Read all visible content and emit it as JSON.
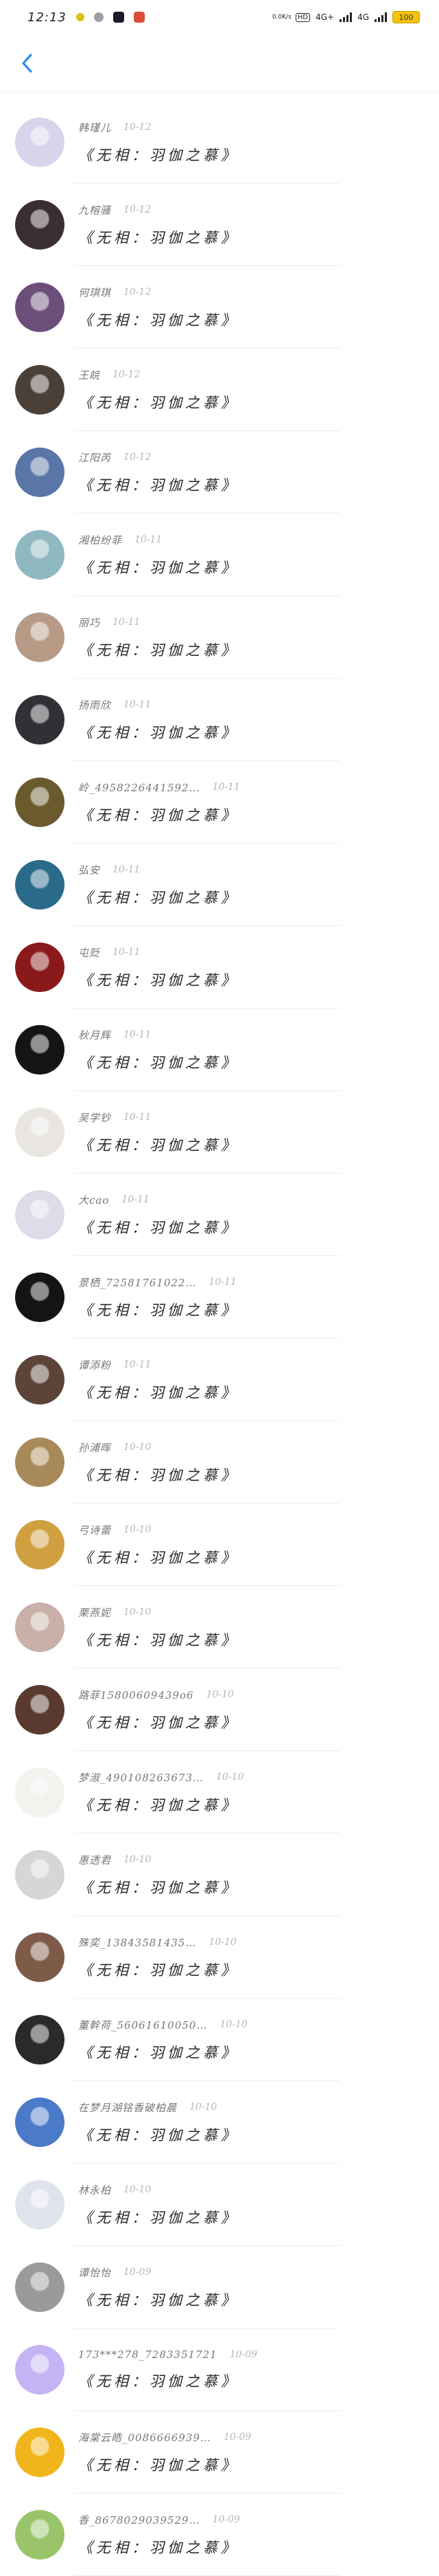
{
  "status": {
    "time": "12:13",
    "network_small": "0.0K/s",
    "net1": "4G+",
    "net2": "4G",
    "battery": "100"
  },
  "colors": {
    "accent": "#2d8cf0",
    "battery": "#f4c20d"
  },
  "nav": {
    "back_icon": "chevron-left-icon"
  },
  "contacts": [
    {
      "name": "韩瑾儿",
      "date": "10-12",
      "message": "《无相：羽伽之慕》",
      "avatar": "#d8d4ec"
    },
    {
      "name": "九榕骚",
      "date": "10-12",
      "message": "《无相：羽伽之慕》",
      "avatar": "#3a2e35"
    },
    {
      "name": "何琪琪",
      "date": "10-12",
      "message": "《无相：羽伽之慕》",
      "avatar": "#6b4e7a"
    },
    {
      "name": "王皖",
      "date": "10-12",
      "message": "《无相：羽伽之慕》",
      "avatar": "#4a4038"
    },
    {
      "name": "江阳芮",
      "date": "10-12",
      "message": "《无相：羽伽之慕》",
      "avatar": "#5a76a8"
    },
    {
      "name": "湘柏纷菲",
      "date": "10-11",
      "message": "《无相：羽伽之慕》",
      "avatar": "#8fb8c0"
    },
    {
      "name": "丽巧",
      "date": "10-11",
      "message": "《无相：羽伽之慕》",
      "avatar": "#b79a86"
    },
    {
      "name": "扬雨欣",
      "date": "10-11",
      "message": "《无相：羽伽之慕》",
      "avatar": "#2f3136"
    },
    {
      "name": "岭_4958226441592…",
      "date": "10-11",
      "message": "《无相：羽伽之慕》",
      "avatar": "#6b5a2e"
    },
    {
      "name": "弘安",
      "date": "10-11",
      "message": "《无相：羽伽之慕》",
      "avatar": "#2a6a8a"
    },
    {
      "name": "屯贬",
      "date": "10-11",
      "message": "《无相：羽伽之慕》",
      "avatar": "#8a1a1a"
    },
    {
      "name": "秋月辉",
      "date": "10-11",
      "message": "《无相：羽伽之慕》",
      "avatar": "#151515"
    },
    {
      "name": "吴学钞",
      "date": "10-11",
      "message": "《无相：羽伽之慕》",
      "avatar": "#e9e6e2"
    },
    {
      "name": "大cao",
      "date": "10-11",
      "message": "《无相：羽伽之慕》",
      "avatar": "#dcdde8"
    },
    {
      "name": "景栖_72581761022…",
      "date": "10-11",
      "message": "《无相：羽伽之慕》",
      "avatar": "#141414"
    },
    {
      "name": "谭添粉",
      "date": "10-11",
      "message": "《无相：羽伽之慕》",
      "avatar": "#5c4438"
    },
    {
      "name": "孙浦晖",
      "date": "10-10",
      "message": "《无相：羽伽之慕》",
      "avatar": "#a88a5a"
    },
    {
      "name": "弓诗蕾",
      "date": "10-10",
      "message": "《无相：羽伽之慕》",
      "avatar": "#d0a040"
    },
    {
      "name": "栗燕妮",
      "date": "10-10",
      "message": "《无相：羽伽之慕》",
      "avatar": "#c9b0a8"
    },
    {
      "name": "路菲15800609439o6",
      "date": "10-10",
      "message": "《无相：羽伽之慕》",
      "avatar": "#5a3a2e"
    },
    {
      "name": "梦淑_490108263673…",
      "date": "10-10",
      "message": "《无相：羽伽之慕》",
      "avatar": "#f4f2ee"
    },
    {
      "name": "惠透君",
      "date": "10-10",
      "message": "《无相：羽伽之慕》",
      "avatar": "#d6d6d6"
    },
    {
      "name": "殊奕_13843581435…",
      "date": "10-10",
      "message": "《无相：羽伽之慕》",
      "avatar": "#7e5a48"
    },
    {
      "name": "董幹荷_56061610050…",
      "date": "10-10",
      "message": "《无相：羽伽之慕》",
      "avatar": "#2a2a2a"
    },
    {
      "name": "在梦月湖铭香破柏晨",
      "date": "10-10",
      "message": "《无相：羽伽之慕》",
      "avatar": "#4a7ac8"
    },
    {
      "name": "林永柏",
      "date": "10-10",
      "message": "《无相：羽伽之慕》",
      "avatar": "#dfe3ec"
    },
    {
      "name": "谭怡怡",
      "date": "10-09",
      "message": "《无相：羽伽之慕》",
      "avatar": "#9a9a9a"
    },
    {
      "name": "173***278_7283351721",
      "date": "10-09",
      "message": "《无相：羽伽之慕》",
      "avatar": "#c4b4f4"
    },
    {
      "name": "海棠云皓_0086666939…",
      "date": "10-09",
      "message": "《无相：羽伽之慕》",
      "avatar": "#f0b51a"
    },
    {
      "name": "香_8678029039529…",
      "date": "10-09",
      "message": "《无相：羽伽之慕》",
      "avatar": "#9ac46a"
    }
  ]
}
